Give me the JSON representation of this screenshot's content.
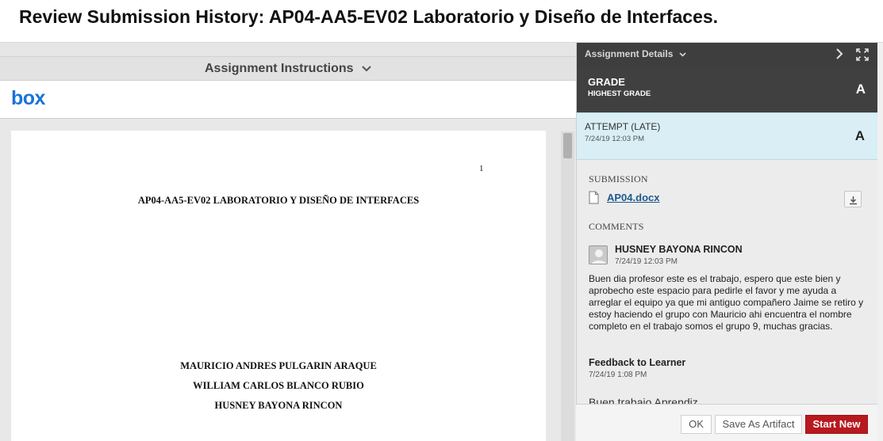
{
  "page": {
    "title": "Review Submission History: AP04-AA5-EV02 Laboratorio y Diseño de Interfaces."
  },
  "left": {
    "instructions_label": "Assignment Instructions",
    "box_logo": "box"
  },
  "document": {
    "page_number": "1",
    "title": "AP04-AA5-EV02 LABORATORIO Y DISEÑO DE INTERFACES",
    "authors": [
      "MAURICIO ANDRES PULGARIN ARAQUE",
      "WILLIAM CARLOS BLANCO RUBIO",
      "HUSNEY BAYONA RINCON"
    ]
  },
  "details": {
    "header_label": "Assignment Details",
    "grade_title": "GRADE",
    "grade_subtitle": "HIGHEST GRADE",
    "grade_value": "A",
    "attempt_title": "ATTEMPT (LATE)",
    "attempt_date": "7/24/19 12:03 PM",
    "attempt_value": "A",
    "submission_label": "SUBMISSION",
    "file_name": "AP04.docx",
    "comments_label": "COMMENTS",
    "commenter_name": "HUSNEY BAYONA RINCON",
    "comment_date": "7/24/19 12:03 PM",
    "comment_text": "Buen dia profesor este es el trabajo, espero que este bien y aprobecho este espacio para pedirle el favor y me ayuda a arreglar el equipo ya que mi antiguo compañero Jaime se retiro y estoy haciendo el grupo con Mauricio ahi encuentra el nombre completo en el trabajo somos el grupo 9, muchas gracias.",
    "feedback_title": "Feedback to Learner",
    "feedback_date": "7/24/19 1:08 PM",
    "feedback_preview": "Buen trabajo Aprendiz"
  },
  "actions": {
    "ok_label": "OK",
    "save_artifact_label": "Save As Artifact",
    "start_new_label": "Start New"
  },
  "colors": {
    "accent_red": "#b7191f",
    "link_blue": "#1d5a8e",
    "attempt_bg": "#d9eef5",
    "dark_panel": "#404040"
  }
}
